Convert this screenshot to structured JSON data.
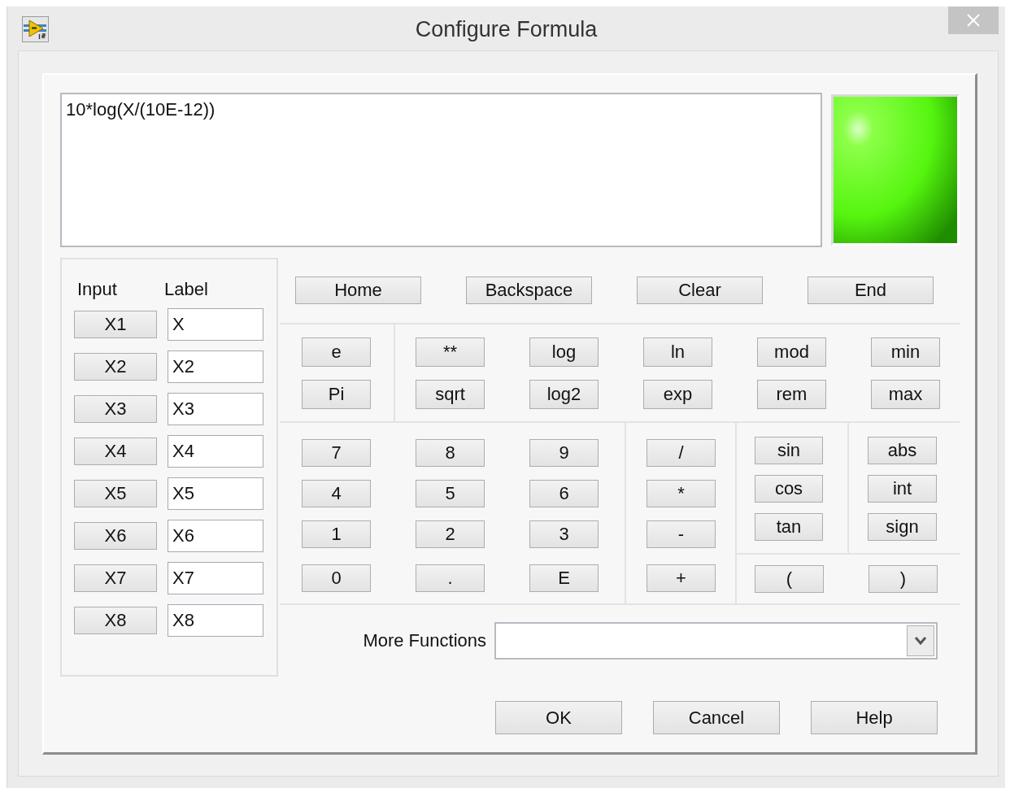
{
  "window": {
    "title": "Configure Formula"
  },
  "formula": {
    "value": "10*log(X/(10E-12))"
  },
  "status_led": {
    "on": true
  },
  "inputs": {
    "columns": [
      "Input",
      "Label"
    ],
    "rows": [
      {
        "input": "X1",
        "label": "X"
      },
      {
        "input": "X2",
        "label": "X2"
      },
      {
        "input": "X3",
        "label": "X3"
      },
      {
        "input": "X4",
        "label": "X4"
      },
      {
        "input": "X5",
        "label": "X5"
      },
      {
        "input": "X6",
        "label": "X6"
      },
      {
        "input": "X7",
        "label": "X7"
      },
      {
        "input": "X8",
        "label": "X8"
      }
    ]
  },
  "edit_buttons": [
    "Home",
    "Backspace",
    "Clear",
    "End"
  ],
  "constant_buttons": [
    "e",
    "Pi"
  ],
  "function_buttons": [
    "**",
    "log",
    "ln",
    "mod",
    "min",
    "sqrt",
    "log2",
    "exp",
    "rem",
    "max"
  ],
  "digit_buttons": [
    "7",
    "8",
    "9",
    "4",
    "5",
    "6",
    "1",
    "2",
    "3",
    "0",
    ".",
    "E"
  ],
  "operator_buttons": [
    "/",
    "*",
    "-",
    "+"
  ],
  "trig_buttons": [
    "sin",
    "cos",
    "tan"
  ],
  "misc_buttons": [
    "abs",
    "int",
    "sign"
  ],
  "paren_buttons": [
    "(",
    ")"
  ],
  "more_functions": {
    "label": "More Functions"
  },
  "dialog_buttons": [
    "OK",
    "Cancel",
    "Help"
  ]
}
